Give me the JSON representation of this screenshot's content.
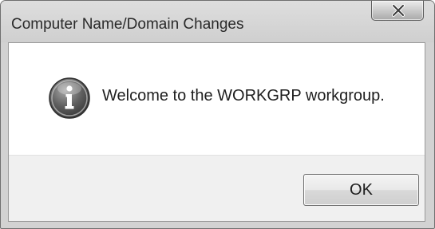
{
  "window": {
    "title": "Computer Name/Domain Changes",
    "close_icon": "close-icon"
  },
  "dialog": {
    "icon": "info-icon",
    "message": "Welcome to the WORKGRP workgroup.",
    "ok_label": "OK"
  }
}
